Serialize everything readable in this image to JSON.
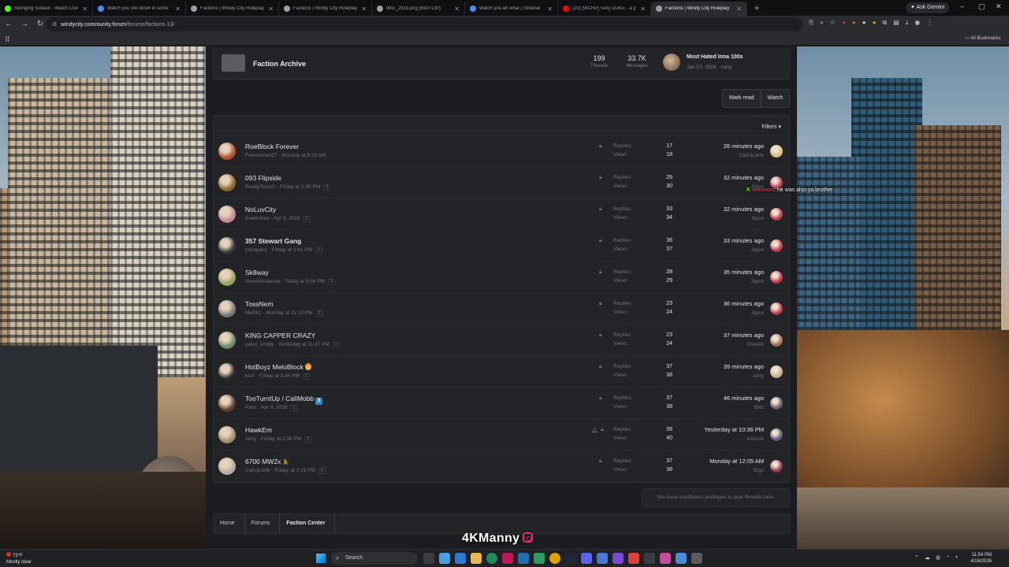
{
  "browser": {
    "tabs": [
      {
        "label": "Swinging Sixteen - Watch Live",
        "color": "#53fc18",
        "active": false
      },
      {
        "label": "Watch you shit down in some",
        "color": "#4c8bf5",
        "active": false
      },
      {
        "label": "Factions | Windy City Roleplay",
        "color": "#9aa0a6",
        "active": false
      },
      {
        "label": "Factions | Windy City Roleplay",
        "color": "#9aa0a6",
        "active": false
      },
      {
        "label": "IMG_2933.png (843×130)",
        "color": "#9aa0a6",
        "active": false
      },
      {
        "label": "Watch you ah what | Streetwi",
        "color": "#4c8bf5",
        "active": false
      },
      {
        "label": "(20) [WCRP] Sixty DUKE - a p",
        "color": "#ff0000",
        "active": false
      },
      {
        "label": "Factions | Windy City Roleplay",
        "color": "#9aa0a6",
        "active": true
      }
    ],
    "ask_gemini": "Ask Gemini",
    "url_host": "windycity.community.forum",
    "url_path": "/forums/factions.13/",
    "all_bookmarks": "All Bookmarks"
  },
  "archive": {
    "title": "Faction Archive",
    "threads_value": "199",
    "threads_label": "Threads",
    "messages_value": "33.7K",
    "messages_label": "Messages",
    "last_title": "Most Hated Inna 100s",
    "last_meta": "Jan 27, 2026 · zarty"
  },
  "actions": {
    "mark_read": "Mark read",
    "watch": "Watch"
  },
  "filters_label": "Filters ▾",
  "labels": {
    "replies": "Replies:",
    "views": "Views:"
  },
  "threads": [
    {
      "title": "RoeBlock Forever",
      "bold": false,
      "author": "Freedamen27",
      "date": "Monday at 8:23 AM",
      "pages": "",
      "replies": "17",
      "views": "18",
      "last_time": "28 minutes ago",
      "last_user": "CaliUpJefe",
      "emoji": "",
      "av": "#b5502a",
      "lav": "#d9c27a"
    },
    {
      "title": "093 Flipside",
      "bold": false,
      "author": "ReallyTrench",
      "date": "Friday at 3:49 PM",
      "pages": "2",
      "replies": "29",
      "views": "30",
      "last_time": "32 minutes ago",
      "last_user": "Jigsw",
      "emoji": "",
      "av": "#8a6a2a",
      "lav": "#c0394b"
    },
    {
      "title": "NoLuvCity",
      "bold": false,
      "author": "Kweenbee",
      "date": "Apr 9, 2026",
      "pages": "2",
      "replies": "33",
      "views": "34",
      "last_time": "32 minutes ago",
      "last_user": "Jigsw",
      "emoji": "",
      "av": "#c48a9a",
      "lav": "#c0394b"
    },
    {
      "title": "357 Stewart Gang",
      "bold": true,
      "author": "kdcapalot",
      "date": "Friday at 3:41 PM",
      "pages": "2",
      "replies": "36",
      "views": "37",
      "last_time": "33 minutes ago",
      "last_user": "Jigsw",
      "emoji": "",
      "av": "#3a3a3a",
      "lav": "#c0394b"
    },
    {
      "title": "Sk8way",
      "bold": false,
      "author": "drewskiicapone",
      "date": "Today at 5:56 PM",
      "pages": "2",
      "replies": "28",
      "views": "29",
      "last_time": "35 minutes ago",
      "last_user": "Jigsw",
      "emoji": "",
      "av": "#9aa35a",
      "lav": "#c0394b"
    },
    {
      "title": "TossNem",
      "bold": false,
      "author": "MeRkz",
      "date": "Monday at 11:13 PM",
      "pages": "2",
      "replies": "23",
      "views": "24",
      "last_time": "36 minutes ago",
      "last_user": "Jigsw",
      "emoji": "",
      "av": "#7a7a7a",
      "lav": "#c0394b"
    },
    {
      "title": "KING CAPPER CRAZY",
      "bold": false,
      "author": "yaboi_smitty",
      "date": "Yesterday at 11:47 PM",
      "pages": "2",
      "replies": "23",
      "views": "24",
      "last_time": "37 minutes ago",
      "last_user": "Dreskiii",
      "emoji": "",
      "av": "#6a8a6a",
      "lav": "#a07050"
    },
    {
      "title": "HotBoyz MeloBlock",
      "bold": false,
      "author": "kez!",
      "date": "Friday at 3:46 PM",
      "pages": "2",
      "replies": "37",
      "views": "38",
      "last_time": "39 minutes ago",
      "last_user": "zarty",
      "emoji": "fire",
      "av": "#2a2a2a",
      "lav": "#c9b08a"
    },
    {
      "title": "TooTurntUp / CaliMobb",
      "bold": false,
      "author": "Pacc",
      "date": "Apr 9, 2026",
      "pages": "2",
      "replies": "37",
      "views": "38",
      "last_time": "46 minutes ago",
      "last_user": "Blitz",
      "emoji": "3",
      "av": "#5a4030",
      "lav": "#6a5a6a"
    },
    {
      "title": "HawkEm",
      "bold": false,
      "author": "zarty",
      "date": "Friday at 2:38 PM",
      "pages": "2",
      "replies": "39",
      "views": "40",
      "last_time": "Yesterday at 10:36 PM",
      "last_user": "kotourz",
      "emoji": "",
      "av": "#a09070",
      "lav": "#5a5a7a",
      "bell": true
    },
    {
      "title": "6700 MW2x",
      "bold": false,
      "author": "CaliUpJefe",
      "date": "Friday at 2:19 PM",
      "pages": "2",
      "replies": "37",
      "views": "38",
      "last_time": "Monday at 12:05 AM",
      "last_user": "itzgil",
      "emoji": "bike",
      "av": "#b0aea0",
      "lav": "#8a3a4a"
    }
  ],
  "no_privileges": "You have insufficient privileges to post threads here.",
  "breadcrumbs": [
    "Home",
    "Forums",
    "Faction Center"
  ],
  "chat": {
    "user": "xxxxxxxx",
    "message": "he was also ya brother"
  },
  "watermark": "4KManny",
  "taskbar": {
    "weather_temp": "73°F",
    "weather_desc": "Mostly clear",
    "search": "Search",
    "time": "11:54 PM",
    "date": "4/16/2026"
  }
}
